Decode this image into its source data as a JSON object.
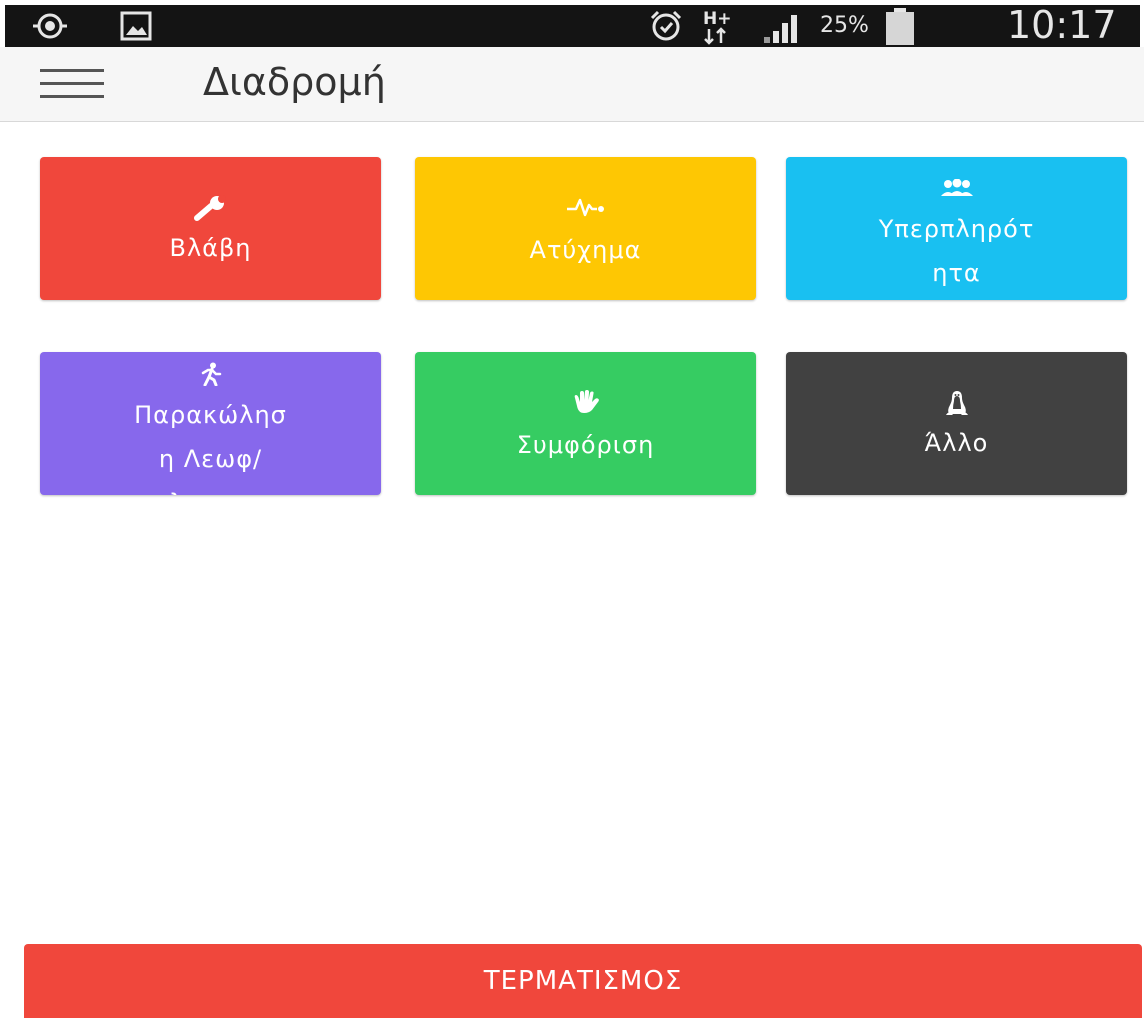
{
  "status_bar": {
    "icons": [
      "gps-icon",
      "image-icon",
      "alarm-icon",
      "hplus-data-icon",
      "signal-icon",
      "battery-icon"
    ],
    "battery_text": "25%",
    "time": "10:17"
  },
  "app_bar": {
    "menu_icon": "hamburger-icon",
    "title": "Διαδρομή"
  },
  "tiles": [
    {
      "label": "Βλάβη",
      "icon": "wrench-icon",
      "color": "#f0473c"
    },
    {
      "label": "Ατύχημα",
      "icon": "heartbeat-icon",
      "color": "#fec703"
    },
    {
      "label_lines": [
        "Υπερπληρότ",
        "ητα"
      ],
      "icon": "users-icon",
      "color": "#19c0f1"
    },
    {
      "label_lines": [
        "Παρακώλησ",
        "η Λεωφ/",
        "λεωφρ"
      ],
      "icon": "walking-person-icon",
      "color": "#8768ec"
    },
    {
      "label": "Συμφόριση",
      "icon": "hand-icon",
      "color": "#36cc62"
    },
    {
      "label": "Άλλο",
      "icon": "linux-icon",
      "color": "#414141"
    }
  ],
  "end_button": {
    "label": "ΤΕΡΜΑΤΙΣΜΟΣ",
    "color": "#f0473c"
  }
}
